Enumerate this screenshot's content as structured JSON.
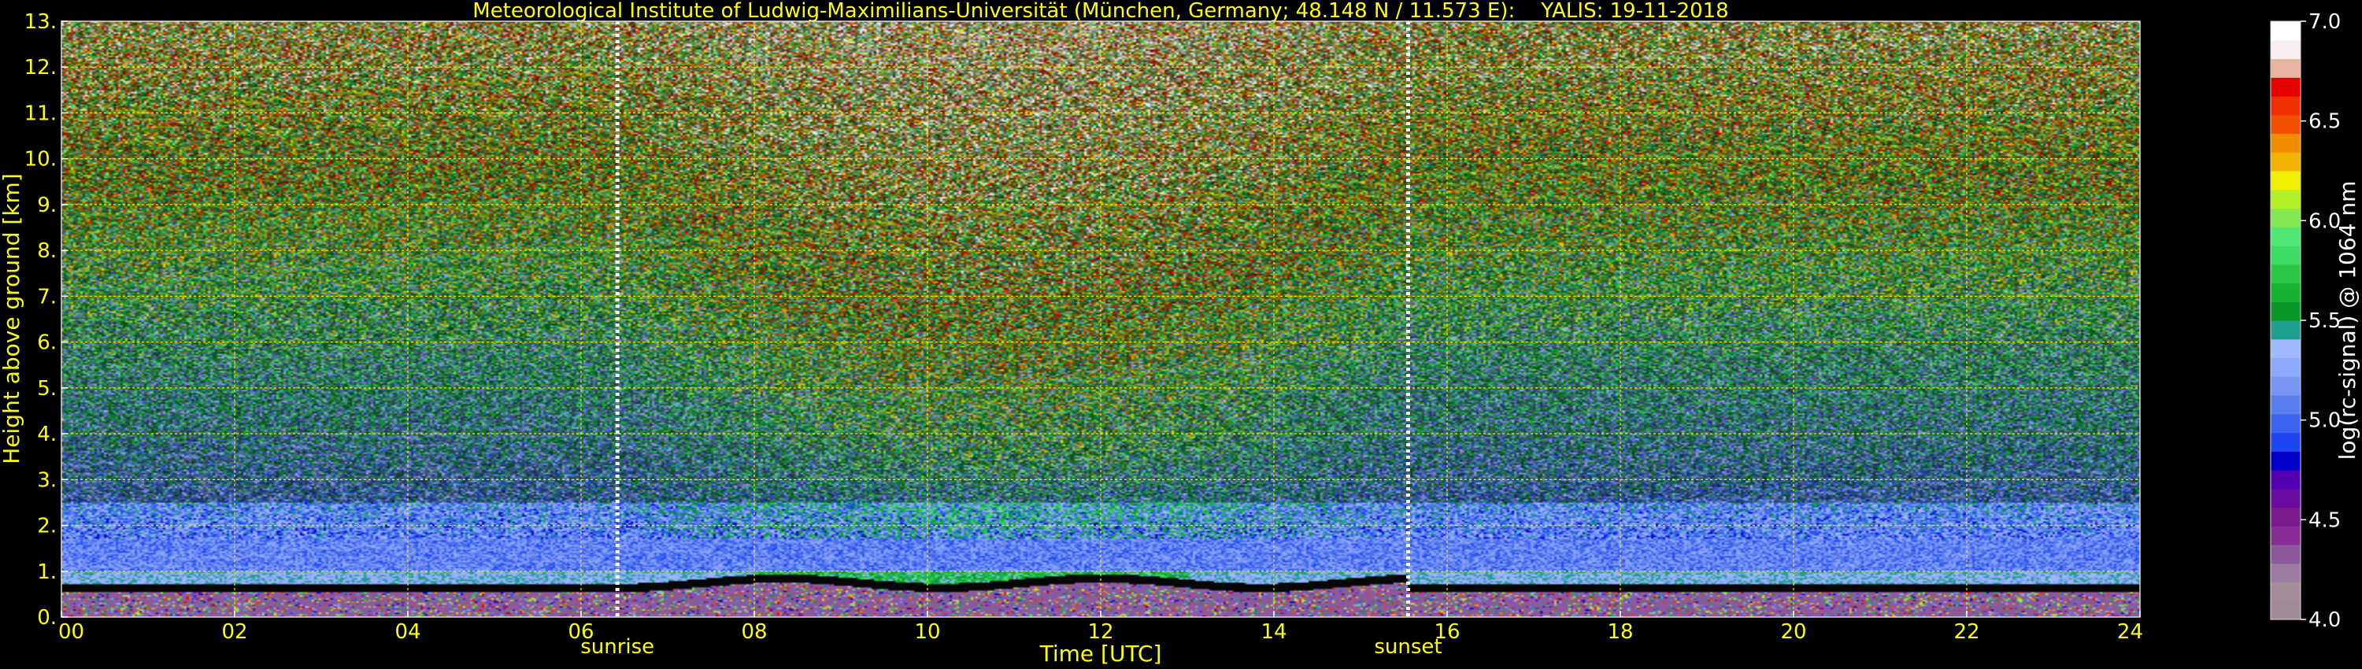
{
  "chart_data": {
    "type": "heatmap",
    "title": "Meteorological Institute of Ludwig-Maximilians-Universität (München, Germany; 48.148 N / 11.573 E):    YALIS: 19-11-2018",
    "xlabel": "Time [UTC]",
    "ylabel": "Height above ground [km]",
    "colorbar_label": "log(rc-signal) @ 1064 nm",
    "xlim": [
      0,
      24
    ],
    "ylim": [
      0,
      13
    ],
    "xticks": [
      {
        "value": 0,
        "label": "00"
      },
      {
        "value": 2,
        "label": "02"
      },
      {
        "value": 4,
        "label": "04"
      },
      {
        "value": 6,
        "label": "06"
      },
      {
        "value": 8,
        "label": "08"
      },
      {
        "value": 10,
        "label": "10"
      },
      {
        "value": 12,
        "label": "12"
      },
      {
        "value": 14,
        "label": "14"
      },
      {
        "value": 16,
        "label": "16"
      },
      {
        "value": 18,
        "label": "18"
      },
      {
        "value": 20,
        "label": "20"
      },
      {
        "value": 22,
        "label": "22"
      },
      {
        "value": 24,
        "label": "24"
      }
    ],
    "yticks": [
      {
        "value": 0,
        "label": "0."
      },
      {
        "value": 1,
        "label": "1."
      },
      {
        "value": 2,
        "label": "2."
      },
      {
        "value": 3,
        "label": "3."
      },
      {
        "value": 4,
        "label": "4."
      },
      {
        "value": 5,
        "label": "5."
      },
      {
        "value": 6,
        "label": "6."
      },
      {
        "value": 7,
        "label": "7."
      },
      {
        "value": 8,
        "label": "8."
      },
      {
        "value": 9,
        "label": "9."
      },
      {
        "value": 10,
        "label": "10."
      },
      {
        "value": 11,
        "label": "11."
      },
      {
        "value": 12,
        "label": "12."
      },
      {
        "value": 13,
        "label": "13."
      }
    ],
    "colorbar": {
      "range": [
        4.0,
        7.0
      ],
      "ticks": [
        {
          "value": 4.0,
          "label": "4.0"
        },
        {
          "value": 4.5,
          "label": "4.5"
        },
        {
          "value": 5.0,
          "label": "5.0"
        },
        {
          "value": 5.5,
          "label": "5.5"
        },
        {
          "value": 6.0,
          "label": "6.0"
        },
        {
          "value": 6.5,
          "label": "6.5"
        },
        {
          "value": 7.0,
          "label": "7.0"
        }
      ],
      "colors": [
        "#a08c96",
        "#a48e9a",
        "#9c7ba0",
        "#8c5a9c",
        "#882d96",
        "#7a1a8c",
        "#6a0aa0",
        "#5000b0",
        "#0000c8",
        "#1e46f0",
        "#3c64f0",
        "#5a7ef0",
        "#7a96f5",
        "#8ca8fa",
        "#a0b8ff",
        "#1ea08c",
        "#0a9628",
        "#14b432",
        "#28c846",
        "#3cdc64",
        "#50e678",
        "#82e650",
        "#b4f028",
        "#f0f000",
        "#f0b400",
        "#f08c00",
        "#f05000",
        "#f03000",
        "#e60000",
        "#e6b4a0",
        "#f8f0f0",
        "#ffffff"
      ]
    },
    "markers": [
      {
        "value": 6.42,
        "label": "sunrise"
      },
      {
        "value": 15.55,
        "label": "sunset"
      }
    ],
    "grid": true,
    "colors": {
      "text": "#ffff00",
      "grid": "#e6e600",
      "background": "#000000",
      "marker": "#ffffff"
    }
  }
}
